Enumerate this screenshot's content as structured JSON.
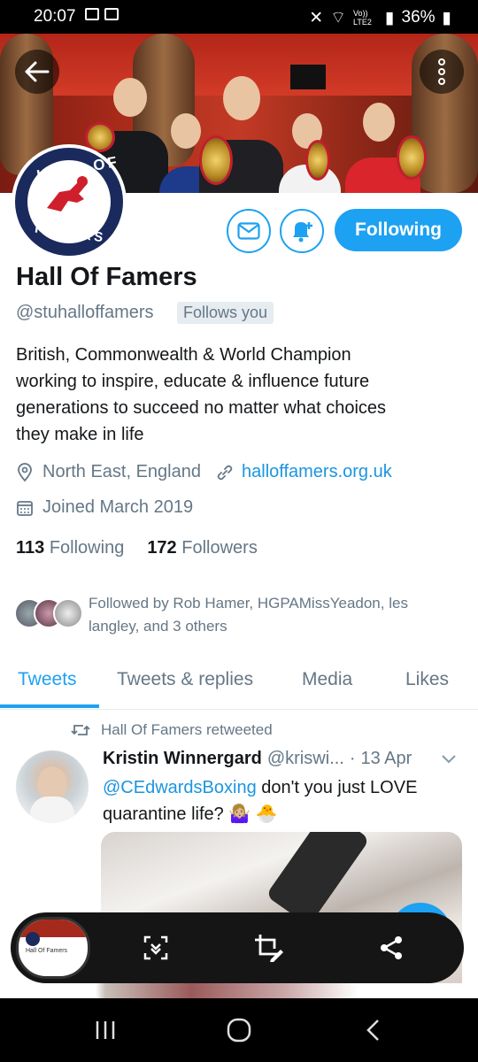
{
  "status_bar": {
    "time": "20:07",
    "signal_label": "Vo)) LTE2",
    "battery": "36%"
  },
  "profile": {
    "name": "Hall Of Famers",
    "handle": "@stuhalloffamers",
    "follows_you": "Follows you",
    "follow_button": "Following",
    "avatar_text_top": "HALL OF",
    "avatar_text_bottom": "FAMERS",
    "bio_lines": [
      "British, Commonwealth & World Champion",
      "working to inspire, educate & influence future",
      "generations to succeed no matter what choices",
      "they make in life"
    ],
    "location": "North East, England",
    "website": "halloffamers.org.uk",
    "joined": "Joined March 2019",
    "following_count": "113",
    "following_label": "Following",
    "followers_count": "172",
    "followers_label": "Followers",
    "followed_by_line1": "Followed by Rob Hamer, HGPAMissYeadon, les",
    "followed_by_line2": "langley, and 3 others"
  },
  "tabs": [
    {
      "label": "Tweets",
      "active": true
    },
    {
      "label": "Tweets & replies",
      "active": false
    },
    {
      "label": "Media",
      "active": false
    },
    {
      "label": "Likes",
      "active": false
    }
  ],
  "tweet": {
    "retweeted_by": "Hall Of Famers retweeted",
    "author_name": "Kristin Winnergard",
    "author_handle": "@kriswi...",
    "separator": "·",
    "date": "13 Apr",
    "mention": "@CEdwardsBoxing",
    "text_rest": " don't you just LOVE",
    "text_line2": "quarantine life? 🤷🏼‍♀️ 🐣"
  },
  "thumbnail": {
    "title": "Hall Of Famers"
  },
  "icons": {
    "back": "arrow-left-icon",
    "more": "more-vertical-icon",
    "message": "mail-icon",
    "notifications": "bell-plus-icon",
    "location": "location-pin-icon",
    "link": "link-icon",
    "calendar": "calendar-icon",
    "retweet": "retweet-icon",
    "capture": "scroll-capture-icon",
    "edit": "crop-edit-icon",
    "share": "share-icon"
  },
  "colors": {
    "accent": "#1da1f2",
    "text": "#14171a",
    "muted": "#657786"
  }
}
